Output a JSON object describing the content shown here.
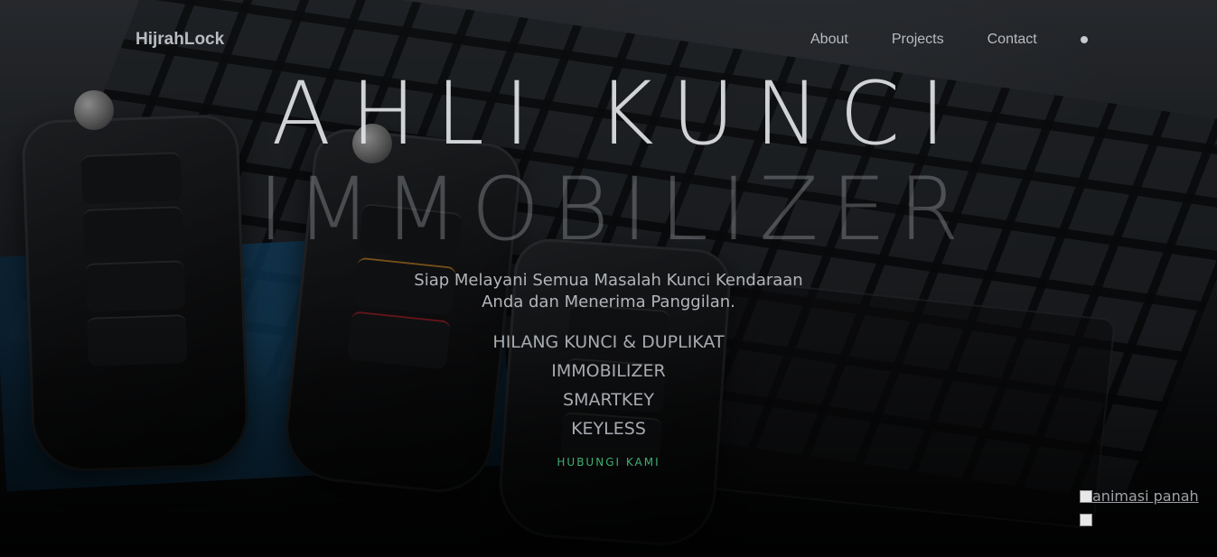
{
  "nav": {
    "brand": "HijrahLock",
    "links": [
      "About",
      "Projects",
      "Contact"
    ],
    "toggle_icon": "dot-icon"
  },
  "hero": {
    "headline_1": "AHLI KUNCI",
    "headline_2": "IMMOBILIZER",
    "subtitle_line_1": "Siap Melayani Semua Masalah Kunci Kendaraan",
    "subtitle_line_2": "Anda dan Menerima Panggilan.",
    "services": [
      "HILANG KUNCI & DUPLIKAT",
      "IMMOBILIZER",
      "SMARTKEY",
      "KEYLESS"
    ],
    "cta_label": "HUBUNGI KAMI",
    "cta_color": "#3fae6e"
  },
  "images": {
    "arrow_alt": "animasi panah"
  }
}
